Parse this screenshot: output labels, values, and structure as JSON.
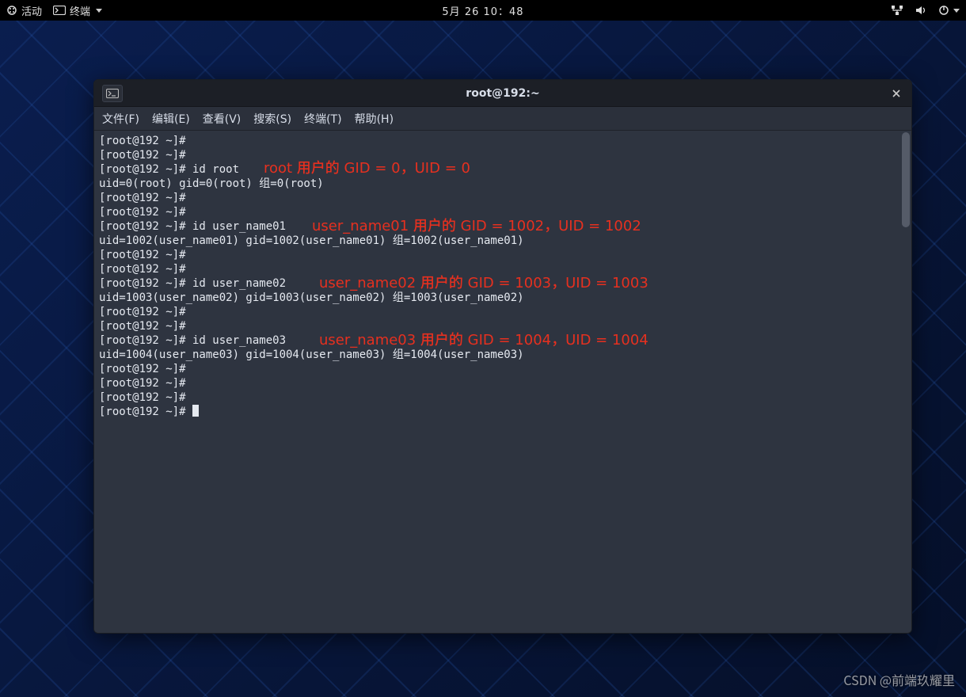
{
  "topbar": {
    "activities": "活动",
    "app_label": "终端",
    "clock": "5月 26 10：48"
  },
  "terminal": {
    "title": "root@192:~",
    "menu": {
      "file": "文件(F)",
      "edit": "编辑(E)",
      "view": "查看(V)",
      "search": "搜索(S)",
      "terminal": "终端(T)",
      "help": "帮助(H)"
    },
    "lines": [
      "[root@192 ~]# ",
      "[root@192 ~]# ",
      "[root@192 ~]# id root",
      "uid=0(root) gid=0(root) 组=0(root)",
      "[root@192 ~]# ",
      "[root@192 ~]# ",
      "[root@192 ~]# id user_name01",
      "uid=1002(user_name01) gid=1002(user_name01) 组=1002(user_name01)",
      "[root@192 ~]# ",
      "[root@192 ~]# ",
      "[root@192 ~]# id user_name02",
      "uid=1003(user_name02) gid=1003(user_name02) 组=1003(user_name02)",
      "[root@192 ~]# ",
      "[root@192 ~]# ",
      "[root@192 ~]# id user_name03",
      "uid=1004(user_name03) gid=1004(user_name03) 组=1004(user_name03)",
      "[root@192 ~]# ",
      "[root@192 ~]# ",
      "[root@192 ~]# ",
      "[root@192 ~]# "
    ],
    "annotations": {
      "a0": "root 用户的 GID = 0，UID = 0",
      "a1": "user_name01 用户的 GID = 1002，UID = 1002",
      "a2": "user_name02 用户的 GID = 1003，UID = 1003",
      "a3": "user_name03 用户的 GID = 1004，UID = 1004"
    }
  },
  "watermark": "CSDN @前端玖耀里"
}
